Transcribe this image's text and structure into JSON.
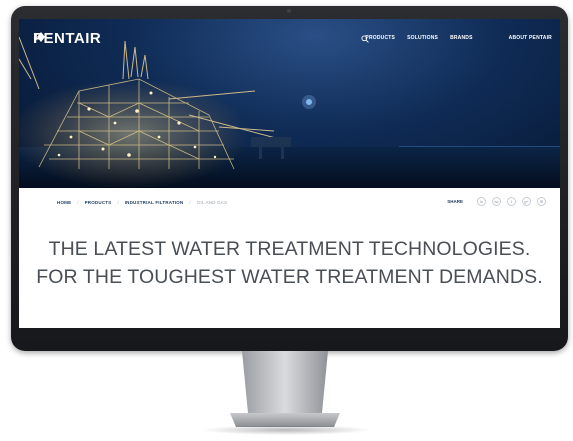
{
  "brand": {
    "name": "PENTAIR"
  },
  "nav": {
    "items": [
      "PRODUCTS",
      "SOLUTIONS",
      "BRANDS"
    ],
    "about": "ABOUT PENTAIR",
    "search_icon": "search-icon"
  },
  "breadcrumb": {
    "items": [
      "HOME",
      "PRODUCTS",
      "INDUSTRIAL FILTRATION"
    ],
    "current": "OIL AND GAS"
  },
  "share": {
    "label": "SHARE",
    "buttons": [
      "in",
      "tw",
      "f",
      "g+",
      "✉"
    ]
  },
  "tagline": {
    "line1": "THE LATEST WATER TREATMENT TECHNOLOGIES.",
    "line2": "FOR THE TOUGHEST WATER TREATMENT DEMANDS."
  },
  "colors": {
    "hero_sky": "#0f2b55",
    "nav_text": "#ffffff",
    "breadcrumb_text": "#1e3a5f",
    "tagline_text": "#4a4f55"
  }
}
